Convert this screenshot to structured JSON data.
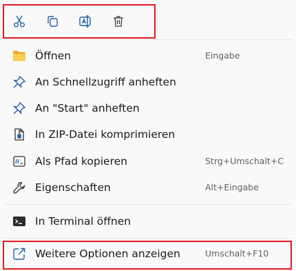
{
  "toolbar": {
    "buttons": [
      {
        "icon": "scissors-icon",
        "action": "cut"
      },
      {
        "icon": "copy-icon",
        "action": "copy"
      },
      {
        "icon": "rename-icon",
        "action": "rename"
      },
      {
        "icon": "trash-icon",
        "action": "delete"
      }
    ]
  },
  "menu": {
    "items": [
      {
        "label": "Öffnen",
        "shortcut": "Eingabe",
        "icon": "folder-icon"
      },
      {
        "label": "An Schnellzugriff anheften",
        "shortcut": "",
        "icon": "pin-icon"
      },
      {
        "label": "An \"Start\" anheften",
        "shortcut": "",
        "icon": "pin-icon"
      },
      {
        "label": "In ZIP-Datei komprimieren",
        "shortcut": "",
        "icon": "zip-icon"
      },
      {
        "label": "Als Pfad kopieren",
        "shortcut": "Strg+Umschalt+C",
        "icon": "path-icon"
      },
      {
        "label": "Eigenschaften",
        "shortcut": "Alt+Eingabe",
        "icon": "wrench-icon"
      },
      {
        "label": "In Terminal öffnen",
        "shortcut": "",
        "icon": "terminal-icon"
      },
      {
        "label": "Weitere Optionen anzeigen",
        "shortcut": "Umschalt+F10",
        "icon": "share-icon"
      }
    ]
  },
  "colors": {
    "accent": "#0067c0",
    "highlight_border": "#e0191f",
    "folder": "#f5c240"
  }
}
